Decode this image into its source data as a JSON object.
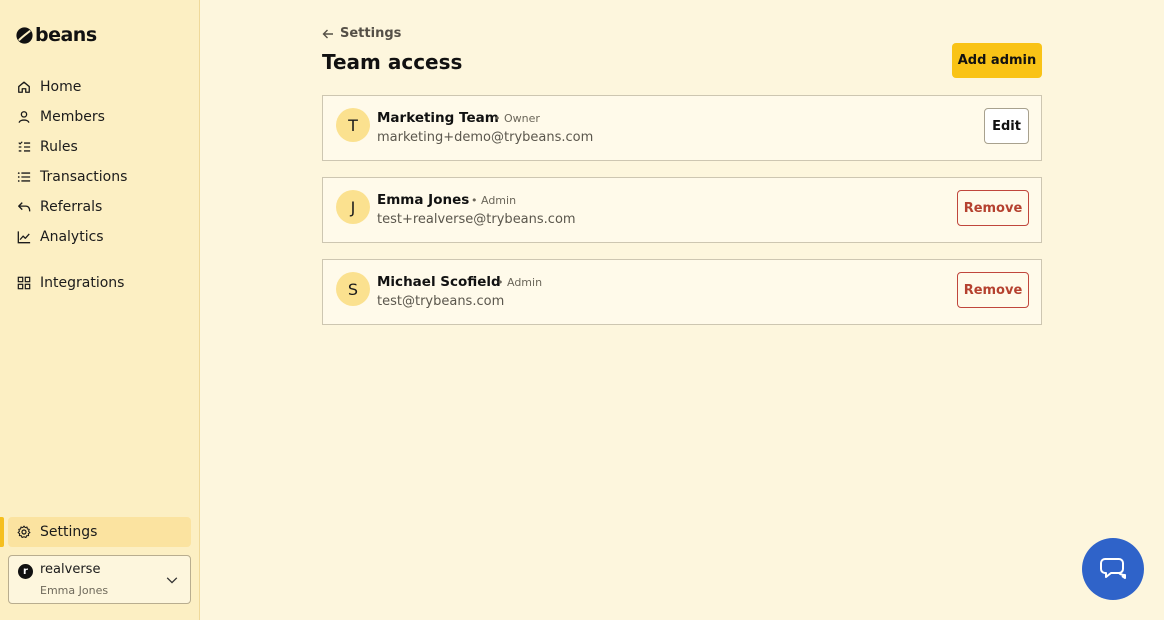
{
  "app": {
    "logo_text": "beans"
  },
  "sidebar": {
    "items": [
      {
        "label": "Home",
        "icon": "home-icon"
      },
      {
        "label": "Members",
        "icon": "user-icon"
      },
      {
        "label": "Rules",
        "icon": "rules-icon"
      },
      {
        "label": "Transactions",
        "icon": "list-icon"
      },
      {
        "label": "Referrals",
        "icon": "reply-arrow-icon"
      },
      {
        "label": "Analytics",
        "icon": "chart-icon"
      },
      {
        "label": "Integrations",
        "icon": "grid-icon"
      }
    ],
    "settings": {
      "label": "Settings",
      "icon": "gear-icon",
      "active": true
    },
    "account": {
      "logo_letter": "r",
      "name": "realverse",
      "user": "Emma Jones"
    }
  },
  "header": {
    "back_label": "Settings",
    "title": "Team access",
    "add_button": "Add admin"
  },
  "members": [
    {
      "initial": "T",
      "name": "Marketing Team",
      "role": "• Owner",
      "email": "marketing+demo@trybeans.com",
      "action": "Edit"
    },
    {
      "initial": "J",
      "name": "Emma Jones",
      "role": "• Admin",
      "email": "test+realverse@trybeans.com",
      "action": "Remove"
    },
    {
      "initial": "S",
      "name": "Michael Scofield",
      "role": "• Admin",
      "email": "test@trybeans.com",
      "action": "Remove"
    }
  ],
  "colors": {
    "accent": "#f9c316",
    "sidebar_bg": "#fcefc3",
    "page_bg": "#fdf6dd",
    "danger": "#b5412f",
    "chat": "#2f63c9"
  }
}
